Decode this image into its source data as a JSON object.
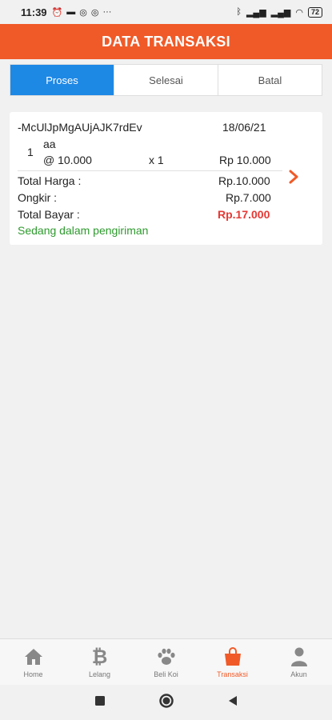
{
  "status_bar": {
    "time": "11:39",
    "notification_icons": [
      "alarm-icon",
      "message-icon",
      "instagram-icon",
      "instagram-icon"
    ],
    "more": "···",
    "battery": "72"
  },
  "app_bar": {
    "title": "DATA TRANSAKSI",
    "color": "#f05a28"
  },
  "tabs": [
    {
      "label": "Proses",
      "active": true
    },
    {
      "label": "Selesai",
      "active": false
    },
    {
      "label": "Batal",
      "active": false
    }
  ],
  "transaction": {
    "id": "-McUlJpMgAUjAJK7rdEv",
    "date": "18/06/21",
    "item": {
      "number": "1",
      "name": "aa",
      "unit_price": "@ 10.000",
      "quantity": "x 1",
      "subtotal": "Rp 10.000"
    },
    "total_harga_label": "Total Harga :",
    "total_harga_value": "Rp.10.000",
    "ongkir_label": "Ongkir :",
    "ongkir_value": "Rp.7.000",
    "total_bayar_label": "Total Bayar :",
    "total_bayar_value": "Rp.17.000",
    "status": "Sedang dalam pengiriman",
    "status_color": "#2e9a2e",
    "total_color": "#e53935"
  },
  "bottom_nav": [
    {
      "label": "Home",
      "icon": "home-icon",
      "active": false
    },
    {
      "label": "Lelang",
      "icon": "bitcoin-icon",
      "active": false
    },
    {
      "label": "Beli Koi",
      "icon": "paw-icon",
      "active": false
    },
    {
      "label": "Transaksi",
      "icon": "shopping-bag-icon",
      "active": true
    },
    {
      "label": "Akun",
      "icon": "person-icon",
      "active": false
    }
  ]
}
